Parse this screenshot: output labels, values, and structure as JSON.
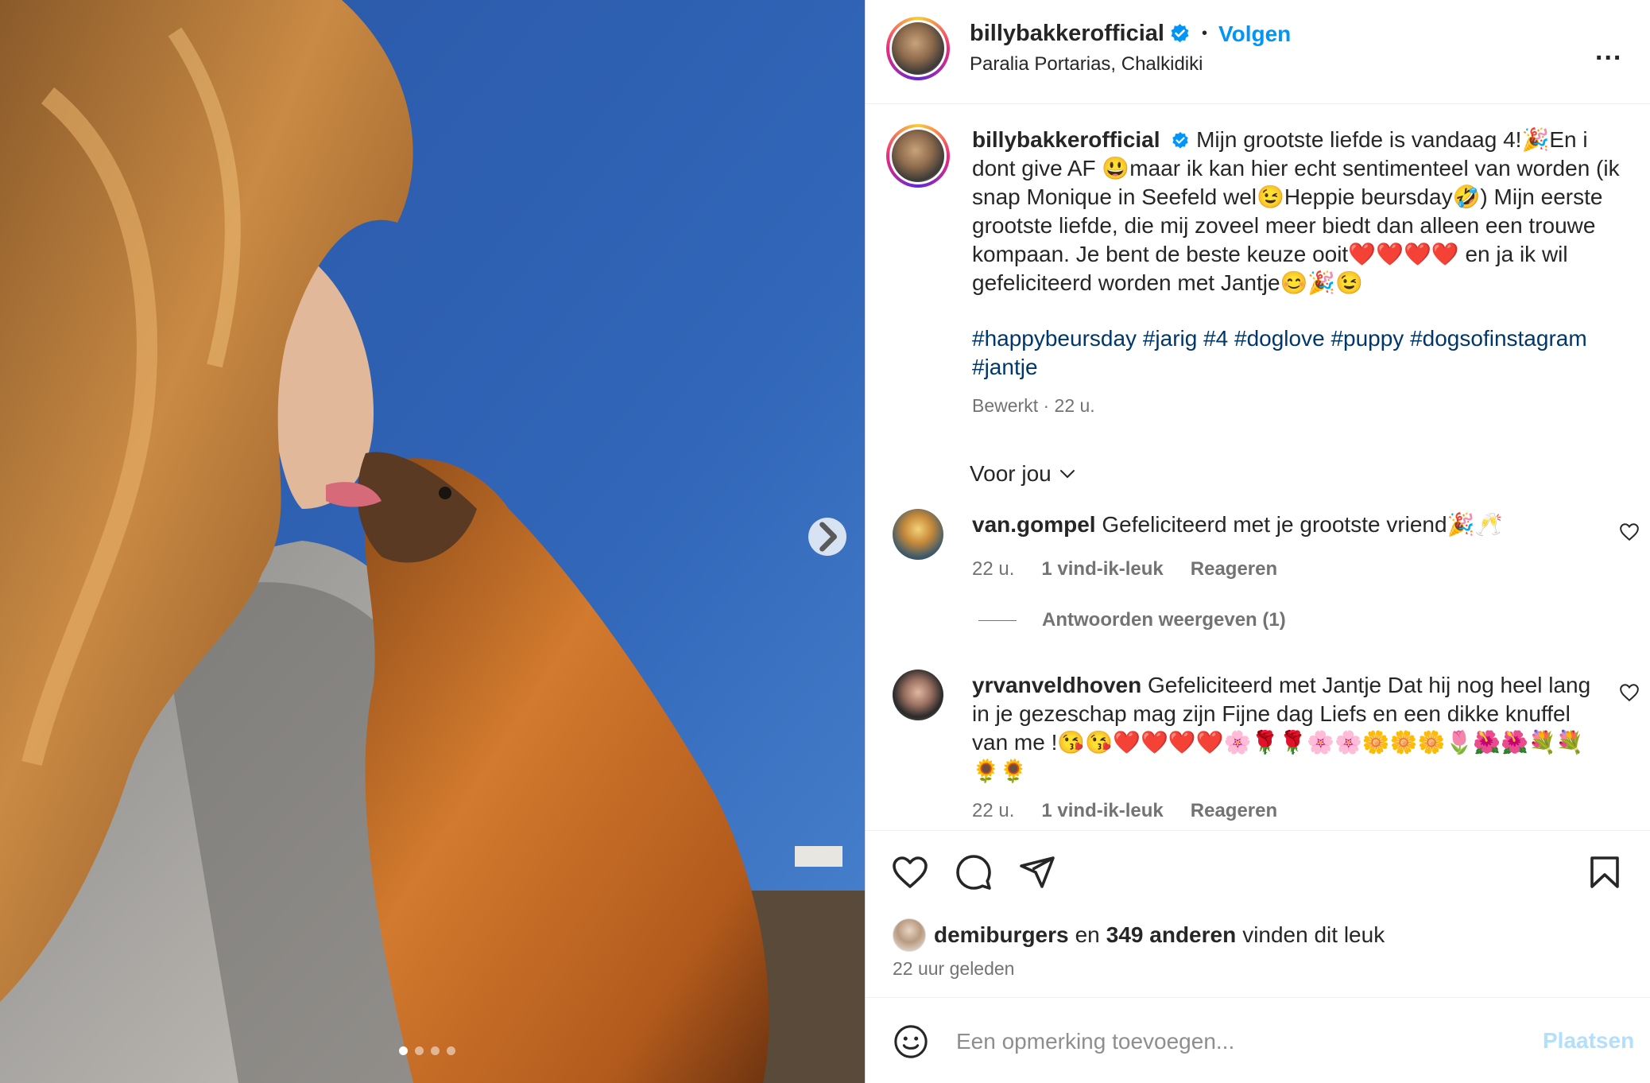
{
  "post": {
    "username": "billybakkerofficial",
    "follow_label": "Volgen",
    "separator": "•",
    "location": "Paralia Portarias, Chalkidiki",
    "more_label": "...",
    "caption": "Mijn grootste liefde is vandaag 4!🎉En i dont give AF 😃maar ik kan hier echt sentimenteel van worden (ik snap Monique in Seefeld wel😉Heppie beursday🤣) Mijn eerste grootste liefde, die mij zoveel meer biedt dan alleen een trouwe kompaan. Je bent de beste keuze ooit❤️❤️❤️❤️ en ja ik wil gefeliciteerd worden met Jantje😊🎉😉",
    "hashtags": "#happybeursday #jarig #4 #doglove #puppy #dogsofinstagram #jantje",
    "meta": "Bewerkt · 22 u."
  },
  "filter": {
    "label": "Voor jou"
  },
  "comments": [
    {
      "username": "van.gompel",
      "text": "Gefeliciteerd met je grootste vriend🎉🥂",
      "time": "22 u.",
      "likes": "1 vind-ik-leuk",
      "reply": "Reageren"
    },
    {
      "username": "yrvanveldhoven",
      "text": "Gefeliciteerd met Jantje Dat hij nog heel lang in je gezeschap mag zijn Fijne dag Liefs en een dikke knuffel van me !😘😘❤️❤️❤️❤️🌸🌹🌹🌸🌸🌼🌼🌼🌷🌺🌺💐💐🌻🌻",
      "time": "22 u.",
      "likes": "1 vind-ik-leuk",
      "reply": "Reageren"
    }
  ],
  "replies_toggle": "Antwoorden weergeven (1)",
  "likes": {
    "liker": "demiburgers",
    "connector": "en",
    "others": "349 anderen",
    "suffix": "vinden dit leuk"
  },
  "time_ago": "22 uur geleden",
  "comment_box": {
    "placeholder": "Een opmerking toevoegen...",
    "post_label": "Plaatsen"
  },
  "carousel": {
    "count": 4,
    "active_index": 0
  },
  "colors": {
    "accent": "#0095f6",
    "hashtag": "#00376b",
    "muted": "#737373",
    "post_disabled": "#b2dffc",
    "sky": "#2f5fb0"
  },
  "icons": [
    "verified-badge-icon",
    "more-icon",
    "chevron-down-icon",
    "chevron-right-icon",
    "heart-icon",
    "comment-icon",
    "share-icon",
    "bookmark-icon",
    "emoji-icon"
  ]
}
